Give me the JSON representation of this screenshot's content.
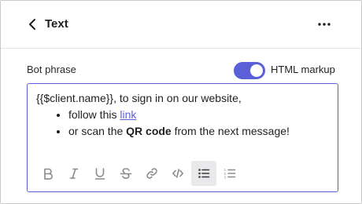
{
  "header": {
    "title": "Text"
  },
  "field": {
    "label": "Bot phrase"
  },
  "toggle": {
    "label": "HTML markup",
    "on": true
  },
  "editor": {
    "intro_var": "{{$client.name}}",
    "intro_rest": ", to sign in on our website,",
    "items": [
      {
        "before": "follow this ",
        "link": "link"
      },
      {
        "before": "or scan the ",
        "bold": "QR code",
        "after": " from the next message!"
      }
    ]
  },
  "toolbar": {
    "buttons": [
      "bold-icon",
      "italic-icon",
      "underline-icon",
      "strikethrough-icon",
      "link-icon",
      "code-icon",
      "bulleted-list-icon",
      "numbered-list-icon"
    ],
    "active": "bulleted-list-icon"
  },
  "colors": {
    "accent": "#5b60d8",
    "icon": "#8a8a8a",
    "text": "#1f1f1f"
  }
}
